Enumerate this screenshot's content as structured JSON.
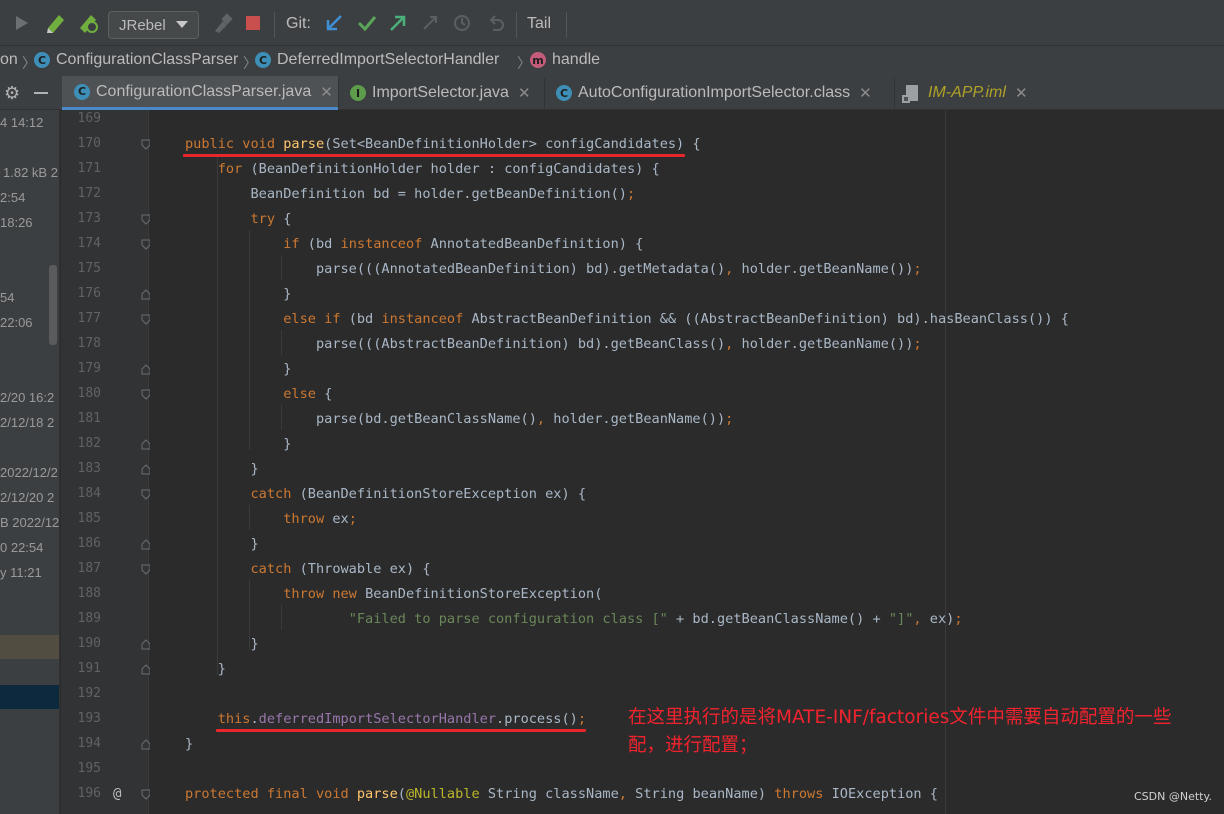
{
  "toolbar": {
    "jrebel_label": "JRebel",
    "git_label": "Git:",
    "tail_label": "Tail",
    "icons": [
      "run-icon",
      "rebel-run-icon",
      "rebel-debug-icon",
      "build-icon",
      "stop-icon",
      "git-update-icon",
      "git-commit-icon",
      "git-push-icon",
      "git-merge-icon",
      "history-icon",
      "rollback-icon"
    ],
    "colors": {
      "update": "#3e8fd6",
      "commit": "#5aa55a",
      "push": "#4bb07c",
      "stop": "#c94f4f"
    }
  },
  "breadcrumb": {
    "items": [
      {
        "label": "on",
        "icon": ""
      },
      {
        "label": "ConfigurationClassParser",
        "icon": "C"
      },
      {
        "label": "DeferredImportSelectorHandler",
        "icon": "C"
      },
      {
        "label": "handle",
        "icon": "m"
      }
    ]
  },
  "tabs": [
    {
      "label": "ConfigurationClassParser.java",
      "icon": "C",
      "active": true
    },
    {
      "label": "ImportSelector.java",
      "icon": "I",
      "active": false
    },
    {
      "label": "AutoConfigurationImportSelector.class",
      "icon": "C",
      "active": false
    },
    {
      "label": "IM-APP.iml",
      "icon": "file",
      "active": false
    }
  ],
  "left_panel": {
    "rows": [
      "4 14:12",
      "1.82 kB 2",
      "2:54",
      "18:26",
      "54",
      "22:06",
      "2/20 16:2",
      "2/12/18 2",
      "2022/12/2",
      "2/12/20 2",
      "B 2022/12",
      "0 22:54",
      "y 11:21"
    ]
  },
  "editor": {
    "line_numbers": [
      "169",
      "170",
      "171",
      "172",
      "173",
      "174",
      "175",
      "176",
      "177",
      "178",
      "179",
      "180",
      "181",
      "182",
      "183",
      "184",
      "185",
      "186",
      "187",
      "188",
      "189",
      "190",
      "191",
      "192",
      "193",
      "194",
      "195",
      "196"
    ],
    "lines": [
      [],
      [
        {
          "t": "public void ",
          "c": "kw"
        },
        {
          "t": "parse",
          "c": "fn"
        },
        {
          "t": "(Set<BeanDefinitionHolder> configCandidates) {",
          "c": ""
        }
      ],
      [
        {
          "t": "    for ",
          "c": "kw"
        },
        {
          "t": "(BeanDefinitionHolder holder : configCandidates) {",
          "c": ""
        }
      ],
      [
        {
          "t": "        BeanDefinition bd = holder.getBeanDefinition()",
          "c": ""
        },
        {
          "t": ";",
          "c": "kw"
        }
      ],
      [
        {
          "t": "        try ",
          "c": "kw"
        },
        {
          "t": "{",
          "c": ""
        }
      ],
      [
        {
          "t": "            if ",
          "c": "kw"
        },
        {
          "t": "(bd ",
          "c": ""
        },
        {
          "t": "instanceof ",
          "c": "kw"
        },
        {
          "t": "AnnotatedBeanDefinition) {",
          "c": ""
        }
      ],
      [
        {
          "t": "                parse(((AnnotatedBeanDefinition) bd).getMetadata()",
          "c": ""
        },
        {
          "t": ", ",
          "c": "kw"
        },
        {
          "t": "holder.getBeanName())",
          "c": ""
        },
        {
          "t": ";",
          "c": "kw"
        }
      ],
      [
        {
          "t": "            }",
          "c": ""
        }
      ],
      [
        {
          "t": "            else if ",
          "c": "kw"
        },
        {
          "t": "(bd ",
          "c": ""
        },
        {
          "t": "instanceof ",
          "c": "kw"
        },
        {
          "t": "AbstractBeanDefinition && ((AbstractBeanDefinition) bd).hasBeanClass()) {",
          "c": ""
        }
      ],
      [
        {
          "t": "                parse(((AbstractBeanDefinition) bd).getBeanClass()",
          "c": ""
        },
        {
          "t": ", ",
          "c": "kw"
        },
        {
          "t": "holder.getBeanName())",
          "c": ""
        },
        {
          "t": ";",
          "c": "kw"
        }
      ],
      [
        {
          "t": "            }",
          "c": ""
        }
      ],
      [
        {
          "t": "            else ",
          "c": "kw"
        },
        {
          "t": "{",
          "c": ""
        }
      ],
      [
        {
          "t": "                parse(bd.getBeanClassName()",
          "c": ""
        },
        {
          "t": ", ",
          "c": "kw"
        },
        {
          "t": "holder.getBeanName())",
          "c": ""
        },
        {
          "t": ";",
          "c": "kw"
        }
      ],
      [
        {
          "t": "            }",
          "c": ""
        }
      ],
      [
        {
          "t": "        }",
          "c": ""
        }
      ],
      [
        {
          "t": "        catch ",
          "c": "kw"
        },
        {
          "t": "(BeanDefinitionStoreException ex) {",
          "c": ""
        }
      ],
      [
        {
          "t": "            throw ",
          "c": "kw"
        },
        {
          "t": "ex",
          "c": ""
        },
        {
          "t": ";",
          "c": "kw"
        }
      ],
      [
        {
          "t": "        }",
          "c": ""
        }
      ],
      [
        {
          "t": "        catch ",
          "c": "kw"
        },
        {
          "t": "(Throwable ex) {",
          "c": ""
        }
      ],
      [
        {
          "t": "            throw new ",
          "c": "kw"
        },
        {
          "t": "BeanDefinitionStoreException(",
          "c": ""
        }
      ],
      [
        {
          "t": "                    ",
          "c": ""
        },
        {
          "t": "\"Failed to parse configuration class [\"",
          "c": "st"
        },
        {
          "t": " + bd.getBeanClassName() + ",
          "c": ""
        },
        {
          "t": "\"]\"",
          "c": "st"
        },
        {
          "t": ", ",
          "c": "kw"
        },
        {
          "t": "ex)",
          "c": ""
        },
        {
          "t": ";",
          "c": "kw"
        }
      ],
      [
        {
          "t": "        }",
          "c": ""
        }
      ],
      [
        {
          "t": "    }",
          "c": ""
        }
      ],
      [],
      [
        {
          "t": "    this",
          "c": "kw"
        },
        {
          "t": ".",
          "c": ""
        },
        {
          "t": "deferredImportSelectorHandler",
          "c": "fld"
        },
        {
          "t": ".process()",
          "c": ""
        },
        {
          "t": ";",
          "c": "kw"
        }
      ],
      [
        {
          "t": "}",
          "c": ""
        }
      ],
      [],
      [
        {
          "t": "protected final void ",
          "c": "kw"
        },
        {
          "t": "parse",
          "c": "fn"
        },
        {
          "t": "(",
          "c": ""
        },
        {
          "t": "@Nullable ",
          "c": "an"
        },
        {
          "t": "String className",
          "c": ""
        },
        {
          "t": ", ",
          "c": "kw"
        },
        {
          "t": "String beanName) ",
          "c": ""
        },
        {
          "t": "throws ",
          "c": "kw"
        },
        {
          "t": "IOException {",
          "c": ""
        }
      ]
    ]
  },
  "annotation_text": "在这里执行的是将MATE-INF/factories文件中需要自动配置的一些配，进行配置；",
  "watermark": "CSDN @Netty."
}
